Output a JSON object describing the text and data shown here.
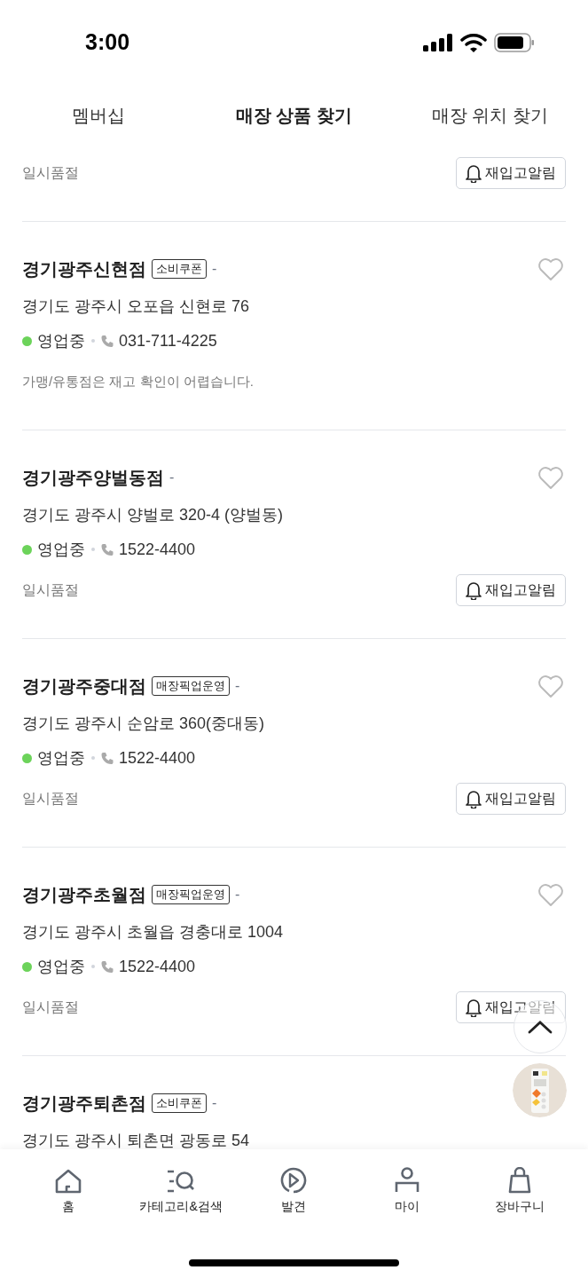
{
  "status_bar": {
    "time": "3:00"
  },
  "tabs": [
    {
      "label": "멤버십",
      "selected": false
    },
    {
      "label": "매장 상품 찾기",
      "selected": true
    },
    {
      "label": "매장 위치 찾기",
      "selected": false
    }
  ],
  "stores": [
    {
      "stock": {
        "kind": "soldout",
        "label": "일시품절",
        "button": "재입고알림"
      }
    },
    {
      "name": "경기광주신현점",
      "badge": "소비쿠폰",
      "dash": "-",
      "favorite": false,
      "address": "경기도 광주시 오포읍 신현로 76",
      "open": true,
      "status": "영업중",
      "phone": "031-711-4225",
      "stock": {
        "kind": "notice",
        "text": "가맹/유통점은 재고 확인이 어렵습니다."
      }
    },
    {
      "name": "경기광주양벌동점",
      "dash": "-",
      "favorite": false,
      "address": "경기도 광주시 양벌로 320-4 (양벌동)",
      "open": true,
      "status": "영업중",
      "phone": "1522-4400",
      "stock": {
        "kind": "soldout",
        "label": "일시품절",
        "button": "재입고알림"
      }
    },
    {
      "name": "경기광주중대점",
      "badge": "매장픽업운영",
      "dash": "-",
      "favorite": false,
      "address": "경기도 광주시 순암로 360(중대동)",
      "open": true,
      "status": "영업중",
      "phone": "1522-4400",
      "stock": {
        "kind": "soldout",
        "label": "일시품절",
        "button": "재입고알림"
      }
    },
    {
      "name": "경기광주초월점",
      "badge": "매장픽업운영",
      "dash": "-",
      "favorite": false,
      "address": "경기도 광주시 초월읍 경충대로 1004",
      "open": true,
      "status": "영업중",
      "phone": "1522-4400",
      "stock": {
        "kind": "soldout",
        "label": "일시품절",
        "button": "재입고알림"
      }
    },
    {
      "name": "경기광주퇴촌점",
      "badge": "소비쿠폰",
      "dash": "-",
      "address": "경기도 광주시 퇴촌면 광동로 54"
    }
  ],
  "bottom_nav": [
    {
      "kind": "home",
      "label": "홈"
    },
    {
      "kind": "search",
      "label": "카테고리&검색"
    },
    {
      "kind": "discover",
      "label": "발견"
    },
    {
      "kind": "my",
      "label": "마이"
    },
    {
      "kind": "cart",
      "label": "장바구니"
    }
  ]
}
